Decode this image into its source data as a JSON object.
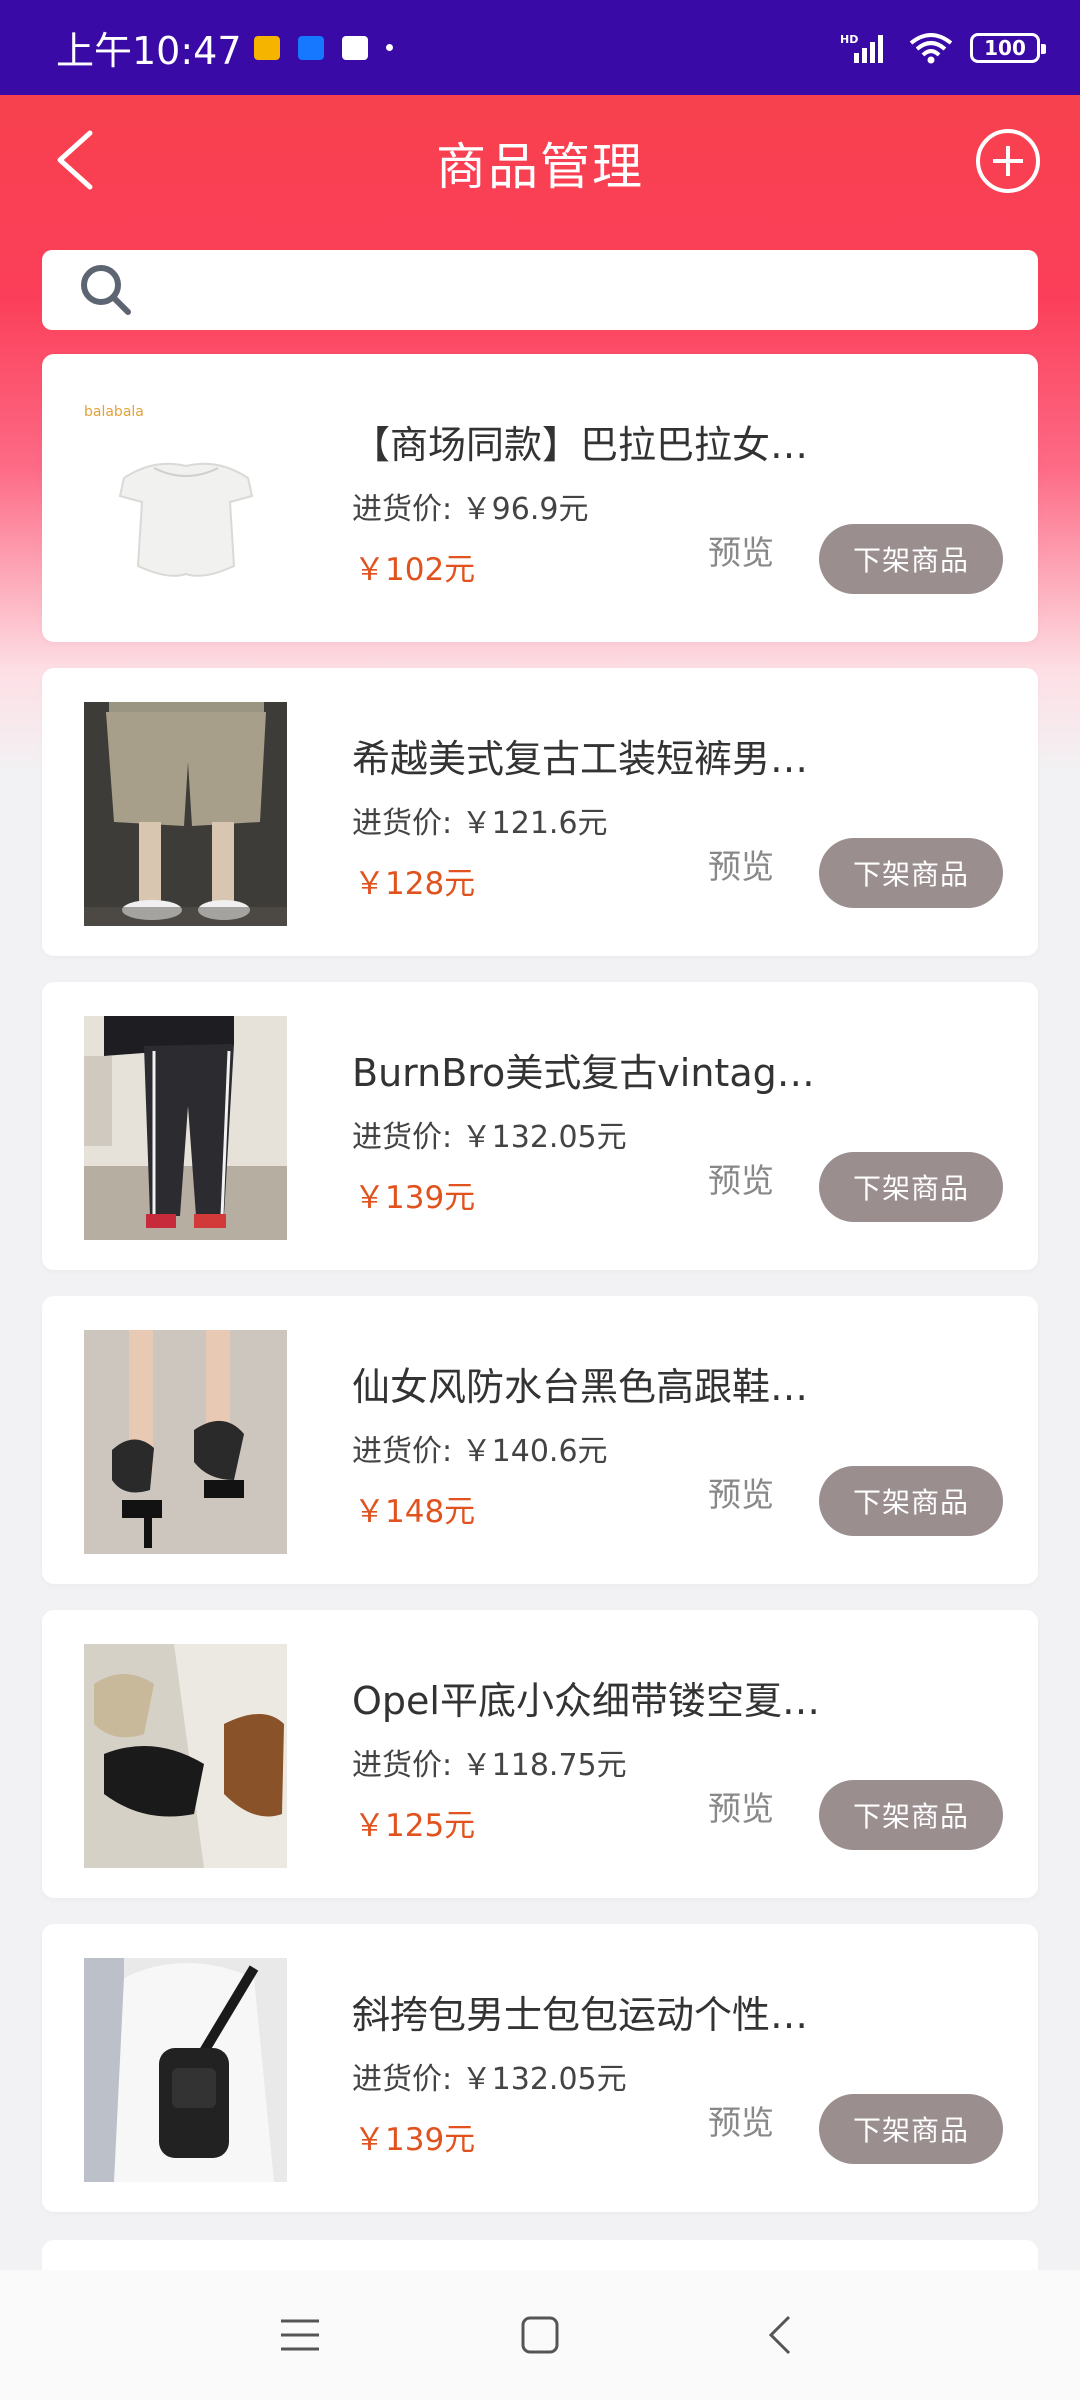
{
  "status_bar": {
    "time": "上午10:47",
    "battery": "100"
  },
  "header": {
    "title": "商品管理"
  },
  "search": {
    "placeholder": ""
  },
  "products": [
    {
      "title": "【商场同款】巴拉巴拉女…",
      "cost": "进货价: ￥96.9元",
      "price": "￥102元",
      "preview": "预览",
      "action": "下架商品",
      "thumb_logo": "balabala"
    },
    {
      "title": "希越美式复古工装短裤男…",
      "cost": "进货价: ￥121.6元",
      "price": "￥128元",
      "preview": "预览",
      "action": "下架商品"
    },
    {
      "title": "BurnBro美式复古vintage…",
      "cost": "进货价: ￥132.05元",
      "price": "￥139元",
      "preview": "预览",
      "action": "下架商品"
    },
    {
      "title": "仙女风防水台黑色高跟鞋…",
      "cost": "进货价: ￥140.6元",
      "price": "￥148元",
      "preview": "预览",
      "action": "下架商品"
    },
    {
      "title": "Opel平底小众细带镂空夏…",
      "cost": "进货价: ￥118.75元",
      "price": "￥125元",
      "preview": "预览",
      "action": "下架商品"
    },
    {
      "title": "斜挎包男士包包运动个性…",
      "cost": "进货价: ￥132.05元",
      "price": "￥139元",
      "preview": "预览",
      "action": "下架商品"
    }
  ],
  "colors": {
    "status_bar": "#3a0aa6",
    "header_gradient": "#f8414e",
    "price": "#e0521e",
    "delist_button": "#9a8e8f"
  }
}
